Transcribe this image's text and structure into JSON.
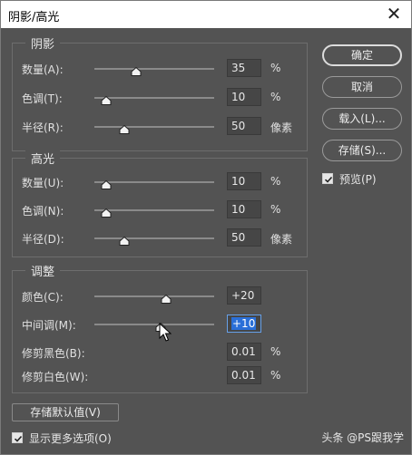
{
  "window": {
    "title": "阴影/高光",
    "close_icon": "close-icon"
  },
  "shadows": {
    "title": "阴影",
    "rows": [
      {
        "label": "数量(A):",
        "value": "35",
        "unit": "%",
        "slider": 0.35
      },
      {
        "label": "色调(T):",
        "value": "10",
        "unit": "%",
        "slider": 0.1
      },
      {
        "label": "半径(R):",
        "value": "50",
        "unit": "像素",
        "slider": 0.25
      }
    ]
  },
  "highlights": {
    "title": "高光",
    "rows": [
      {
        "label": "数量(U):",
        "value": "10",
        "unit": "%",
        "slider": 0.1
      },
      {
        "label": "色调(N):",
        "value": "10",
        "unit": "%",
        "slider": 0.1
      },
      {
        "label": "半径(D):",
        "value": "50",
        "unit": "像素",
        "slider": 0.25
      }
    ]
  },
  "adjust": {
    "title": "调整",
    "rows": [
      {
        "label": "颜色(C):",
        "value": "+20",
        "unit": "",
        "slider": 0.6
      },
      {
        "label": "中间调(M):",
        "value": "+10",
        "unit": "",
        "slider": 0.55
      },
      {
        "label": "修剪黑色(B):",
        "value": "0.01",
        "unit": "%"
      },
      {
        "label": "修剪白色(W):",
        "value": "0.01",
        "unit": "%"
      }
    ]
  },
  "buttons": {
    "ok": "确定",
    "cancel": "取消",
    "load": "载入(L)...",
    "save": "存储(S)...",
    "save_default": "存储默认值(V)"
  },
  "checkboxes": {
    "preview": {
      "label": "预览(P)",
      "checked": true
    },
    "more_options": {
      "label": "显示更多选项(O)",
      "checked": true
    }
  },
  "watermark": "头条 @PS跟我学"
}
